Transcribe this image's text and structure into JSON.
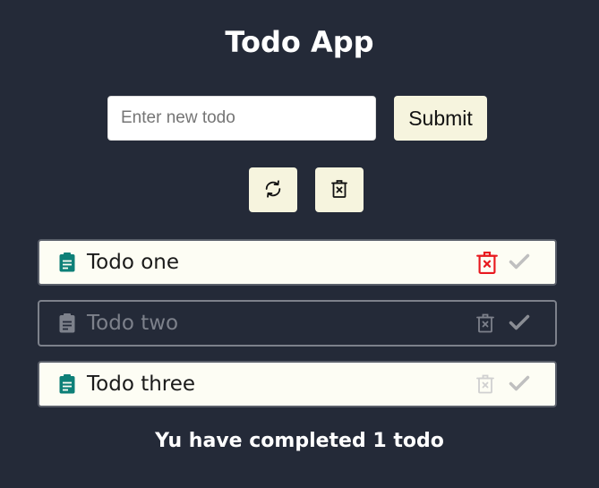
{
  "app": {
    "title": "Todo App"
  },
  "form": {
    "input_value": "",
    "input_placeholder": "Enter new todo",
    "submit_label": "Submit"
  },
  "toolbar": {
    "refresh_icon": "refresh-icon",
    "clear_all_icon": "trash-x-icon"
  },
  "todos": [
    {
      "text": "Todo one",
      "completed": false,
      "icon": "clipboard-icon",
      "delete_highlighted": true
    },
    {
      "text": "Todo two",
      "completed": true,
      "icon": "clipboard-icon",
      "delete_highlighted": false
    },
    {
      "text": "Todo three",
      "completed": false,
      "icon": "clipboard-icon",
      "delete_highlighted": false
    }
  ],
  "summary": "Yu have completed 1 todo",
  "colors": {
    "background": "#242a38",
    "item_background": "#fdfdf4",
    "button_background": "#f6f4de",
    "note_icon_active": "#0e8078",
    "note_icon_done": "#7d818b",
    "delete_highlight": "#e8191f",
    "delete_done": "#7d818b",
    "delete_default": "#d0d0d0",
    "check_icon": "#bfbfbf",
    "check_icon_done": "#8a8d94"
  }
}
